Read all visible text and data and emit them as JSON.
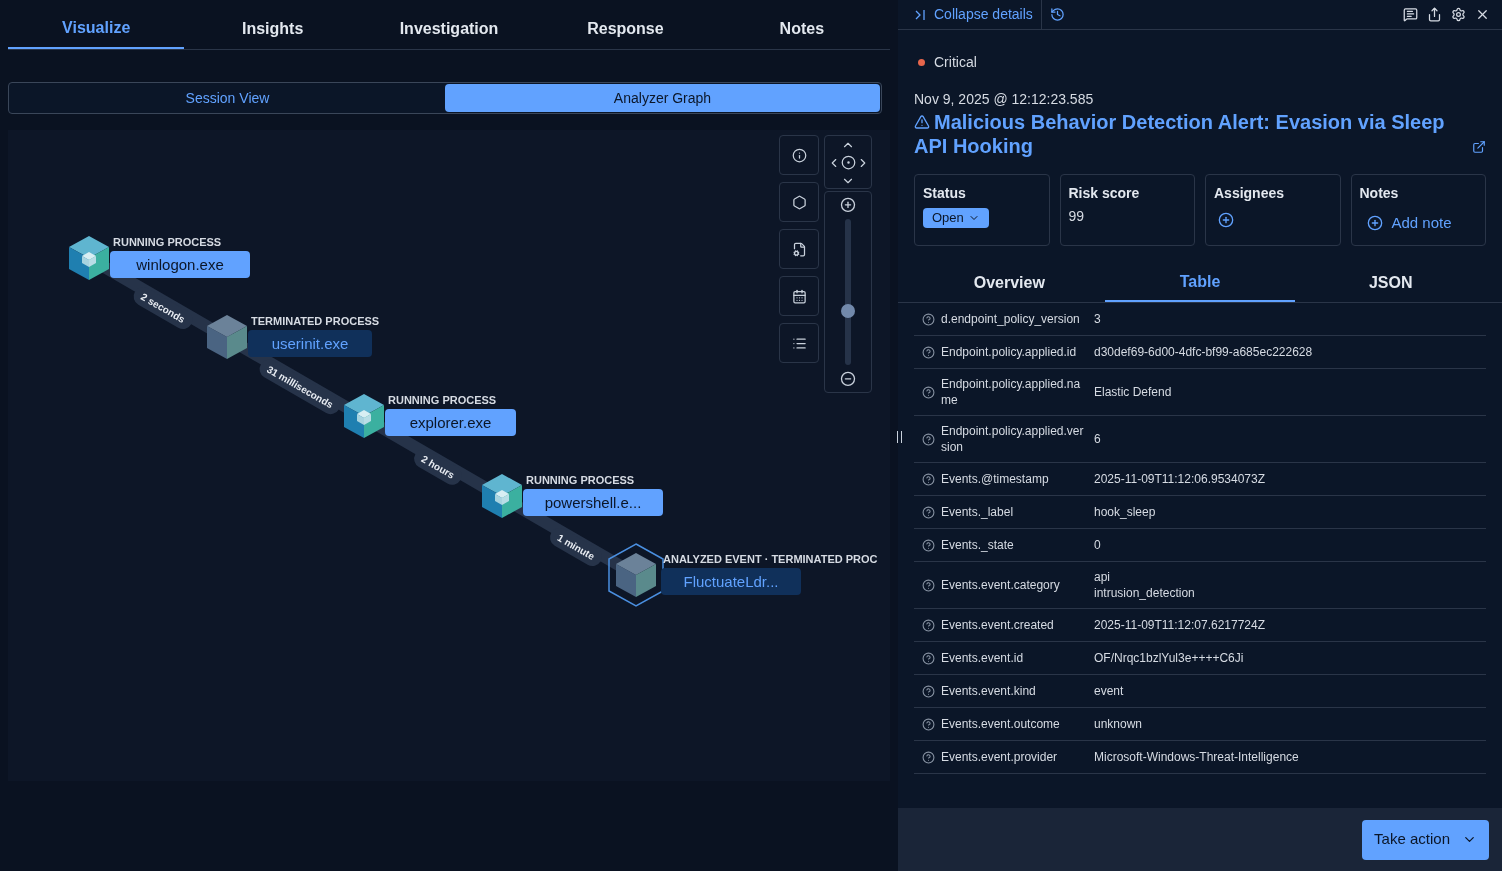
{
  "tabs": [
    {
      "label": "Visualize",
      "selected": true
    },
    {
      "label": "Insights",
      "selected": false
    },
    {
      "label": "Investigation",
      "selected": false
    },
    {
      "label": "Response",
      "selected": false
    },
    {
      "label": "Notes",
      "selected": false
    }
  ],
  "views": [
    {
      "label": "Session View",
      "selected": false
    },
    {
      "label": "Analyzer Graph",
      "selected": true
    }
  ],
  "graph": {
    "nodes": [
      {
        "kind": "running",
        "type": "RUNNING PROCESS",
        "name": "winlogon.exe"
      },
      {
        "kind": "terminated",
        "type": "TERMINATED PROCESS",
        "name": "userinit.exe"
      },
      {
        "kind": "running",
        "type": "RUNNING PROCESS",
        "name": "explorer.exe"
      },
      {
        "kind": "running",
        "type": "RUNNING PROCESS",
        "name": "powershell.e..."
      },
      {
        "kind": "analyzed",
        "type": "ANALYZED EVENT · TERMINATED PROC",
        "name": "FluctuateLdr..."
      }
    ],
    "edges": [
      "2 seconds",
      "31 milliseconds",
      "2 hours",
      "1 minute"
    ],
    "zoom": {
      "level": 0.37
    }
  },
  "details": {
    "collapse": "Collapse details",
    "severity": {
      "label": "Critical",
      "color": "#e7664c"
    },
    "timestamp": "Nov 9, 2025 @ 12:12:23.585",
    "title": "Malicious Behavior Detection Alert: Evasion via Sleep API Hooking",
    "cards": [
      {
        "kind": "status",
        "title": "Status",
        "value": "Open"
      },
      {
        "kind": "text",
        "title": "Risk score",
        "value": "99"
      },
      {
        "kind": "add",
        "title": "Assignees"
      },
      {
        "kind": "add",
        "title": "Notes",
        "value": "Add note"
      }
    ],
    "tabs": [
      {
        "label": "Overview",
        "selected": false
      },
      {
        "label": "Table",
        "selected": true
      },
      {
        "label": "JSON",
        "selected": false
      }
    ],
    "rows": [
      {
        "field": "d.endpoint_policy_version",
        "value": [
          "3"
        ]
      },
      {
        "field": "Endpoint.policy.applied.id",
        "value": [
          "d30def69-6d00-4dfc-bf99-a685ec222628"
        ]
      },
      {
        "field": "Endpoint.policy.applied.name",
        "value": [
          "Elastic Defend"
        ]
      },
      {
        "field": "Endpoint.policy.applied.version",
        "value": [
          "6"
        ]
      },
      {
        "field": "Events.@timestamp",
        "value": [
          "2025-11-09T11:12:06.9534073Z"
        ]
      },
      {
        "field": "Events._label",
        "value": [
          "hook_sleep"
        ]
      },
      {
        "field": "Events._state",
        "value": [
          "0"
        ]
      },
      {
        "field": "Events.event.category",
        "value": [
          "api",
          "intrusion_detection"
        ]
      },
      {
        "field": "Events.event.created",
        "value": [
          "2025-11-09T11:12:07.6217724Z"
        ]
      },
      {
        "field": "Events.event.id",
        "value": [
          "OF/Nrqc1bzlYul3e++++C6Ji"
        ]
      },
      {
        "field": "Events.event.kind",
        "value": [
          "event"
        ]
      },
      {
        "field": "Events.event.outcome",
        "value": [
          "unknown"
        ]
      },
      {
        "field": "Events.event.provider",
        "value": [
          "Microsoft-Windows-Threat-Intelligence"
        ]
      }
    ],
    "action": "Take action"
  }
}
